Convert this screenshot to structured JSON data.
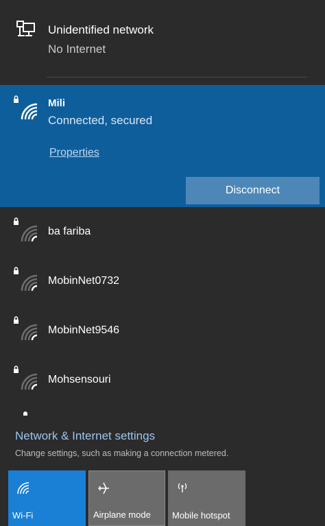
{
  "unidentified": {
    "title": "Unidentified network",
    "status": "No Internet"
  },
  "connected": {
    "name": "Mili",
    "status": "Connected, secured",
    "properties_label": "Properties",
    "disconnect_label": "Disconnect"
  },
  "networks": [
    {
      "name": "ba fariba"
    },
    {
      "name": "MobinNet0732"
    },
    {
      "name": "MobinNet9546"
    },
    {
      "name": "Mohsensouri"
    }
  ],
  "settings": {
    "link": "Network & Internet settings",
    "description": "Change settings, such as making a connection metered."
  },
  "quick_actions": [
    {
      "label": "Wi-Fi",
      "icon": "wifi-icon",
      "active": true
    },
    {
      "label": "Airplane mode",
      "icon": "airplane-icon",
      "active": false
    },
    {
      "label": "Mobile hotspot",
      "icon": "hotspot-icon",
      "active": false
    }
  ],
  "colors": {
    "background": "#2b2b2b",
    "selected_bg": "#0f5e9c",
    "accent": "#1a80d6",
    "link": "#9cc5f0"
  }
}
